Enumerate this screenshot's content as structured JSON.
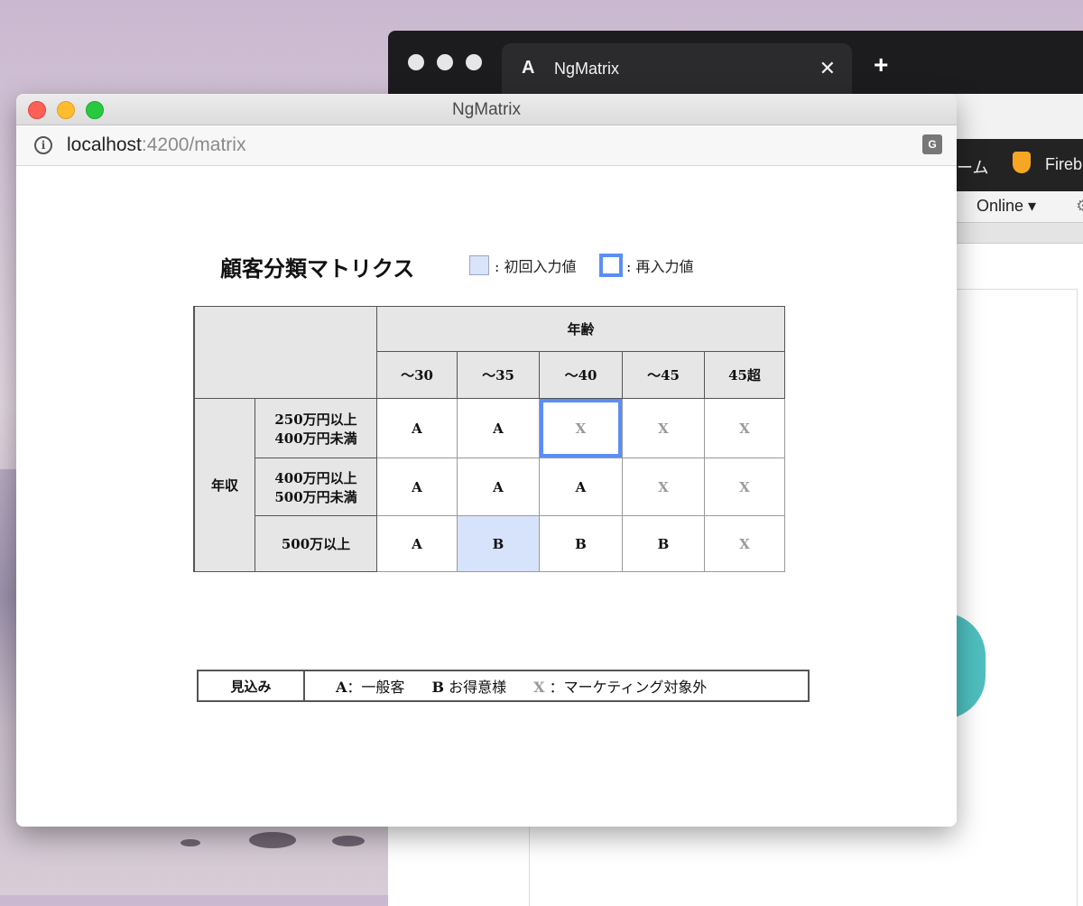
{
  "back_window": {
    "tab_title": "NgMatrix",
    "tab_close": "✕",
    "new_tab": "+",
    "bookmark_partial": "ーム",
    "bookmark_firebase_partial": "Fireb",
    "devtools_online": "Online ▾"
  },
  "window": {
    "title": "NgMatrix",
    "url_host": "localhost",
    "url_path": ":4200/matrix"
  },
  "page": {
    "title": "顧客分類マトリクス",
    "legend_initial": ": 初回入力値",
    "legend_reentry": ": 再入力値"
  },
  "matrix": {
    "age_header": "年齢",
    "age_columns": [
      "〜30",
      "〜35",
      "〜40",
      "〜45",
      "45超"
    ],
    "income_header": "年収",
    "rows": [
      {
        "label_line1": "250万円以上",
        "label_line2": "400万円未満",
        "cells": [
          "A",
          "A",
          "X",
          "X",
          "X"
        ]
      },
      {
        "label_line1": "400万円以上",
        "label_line2": "500万円未満",
        "cells": [
          "A",
          "A",
          "A",
          "X",
          "X"
        ]
      },
      {
        "label_line1": "500万以上",
        "label_line2": "",
        "cells": [
          "A",
          "B",
          "B",
          "B",
          "X"
        ]
      }
    ]
  },
  "key": {
    "label": "見込み",
    "a_symbol": "A",
    "a_text": "：一般客",
    "b_symbol": "B",
    "b_text": "お得意様",
    "x_symbol": "X",
    "x_text": "：マーケティング対象外"
  }
}
